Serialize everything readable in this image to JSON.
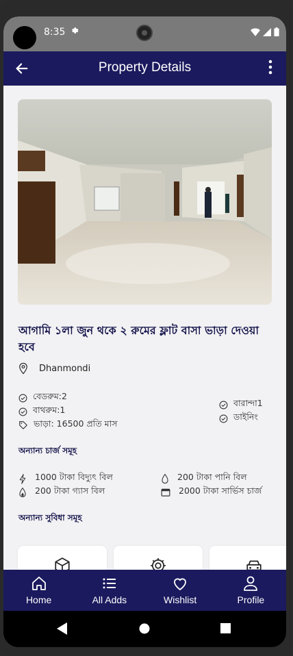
{
  "status_bar": {
    "time": "8:35"
  },
  "app_bar": {
    "title": "Property Details"
  },
  "property": {
    "title": "আগামি ১লা জুন থকে ২ রুমের ফ্লাট বাসা ভাড়া দেওয়া হবে",
    "location": "Dhanmondi",
    "features_left": [
      {
        "icon": "check-circle-icon",
        "label": "বেডরুম:2"
      },
      {
        "icon": "check-circle-icon",
        "label": "বাথরুম:1"
      },
      {
        "icon": "tag-icon",
        "label": "ভাড়া: 16500 প্রতি মাস"
      }
    ],
    "features_right": [
      {
        "icon": "check-circle-icon",
        "label": "বারান্দা1"
      },
      {
        "icon": "check-circle-icon",
        "label": "ডাইনিং"
      }
    ]
  },
  "charges": {
    "heading": "অন্যান্য চার্জ সমূহ",
    "items": [
      {
        "icon": "bolt-icon",
        "label": "1000 টাকা বিদ্যুৎ বিল"
      },
      {
        "icon": "water-drop-icon",
        "label": "200 টাকা পানি বিল"
      },
      {
        "icon": "gas-flame-icon",
        "label": "200 টাকা গ্যাস বিল"
      },
      {
        "icon": "calendar-icon",
        "label": "2000 টাকা সার্ভিস চার্জ"
      }
    ]
  },
  "facilities": {
    "heading": "অন্যান্য সুবিধা সমূহ",
    "cards": [
      {
        "icon": "box-icon"
      },
      {
        "icon": "gear-icon"
      },
      {
        "icon": "car-icon"
      }
    ]
  },
  "bottom_nav": {
    "items": [
      {
        "icon": "home-icon",
        "label": "Home"
      },
      {
        "icon": "list-icon",
        "label": "All Adds"
      },
      {
        "icon": "heart-icon",
        "label": "Wishlist"
      },
      {
        "icon": "person-icon",
        "label": "Profile"
      }
    ]
  }
}
